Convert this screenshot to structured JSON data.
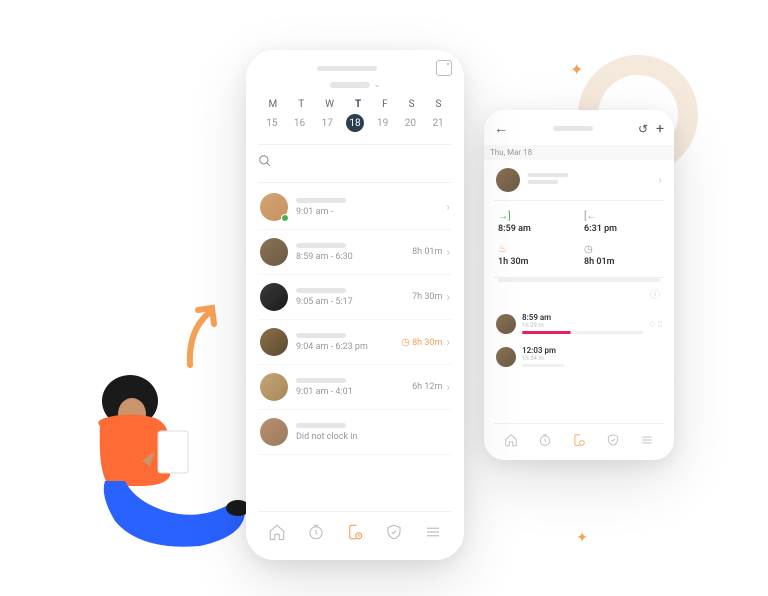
{
  "week": {
    "days": [
      "M",
      "T",
      "W",
      "T",
      "F",
      "S",
      "S"
    ],
    "dates": [
      "15",
      "16",
      "17",
      "18",
      "19",
      "20",
      "21"
    ],
    "selected_index": 3
  },
  "list": [
    {
      "time": "9:01 am -",
      "duration": ""
    },
    {
      "time": "8:59 am - 6:30",
      "duration": "8h 01m"
    },
    {
      "time": "9:05 am - 5:17",
      "duration": "7h 30m"
    },
    {
      "time": "9:04 am - 6:23 pm",
      "duration": "8h 30m",
      "accent": true,
      "clock": true
    },
    {
      "time": "9:01 am - 4:01",
      "duration": "6h 12m"
    },
    {
      "time": "Did not clock in",
      "duration": ""
    }
  ],
  "detail": {
    "date_label": "Thu, Mar 18",
    "clock_in": {
      "label": "",
      "value": "8:59 am"
    },
    "clock_out": {
      "label": "",
      "value": "6:31 pm"
    },
    "break": {
      "label": "",
      "value": "1h 30m"
    },
    "total": {
      "label": "",
      "value": "8h 01m"
    },
    "entries": [
      {
        "time": "8:59 am",
        "sub": "1h 29 m"
      },
      {
        "time": "12:03 pm",
        "sub": "1h 34 m"
      }
    ]
  }
}
